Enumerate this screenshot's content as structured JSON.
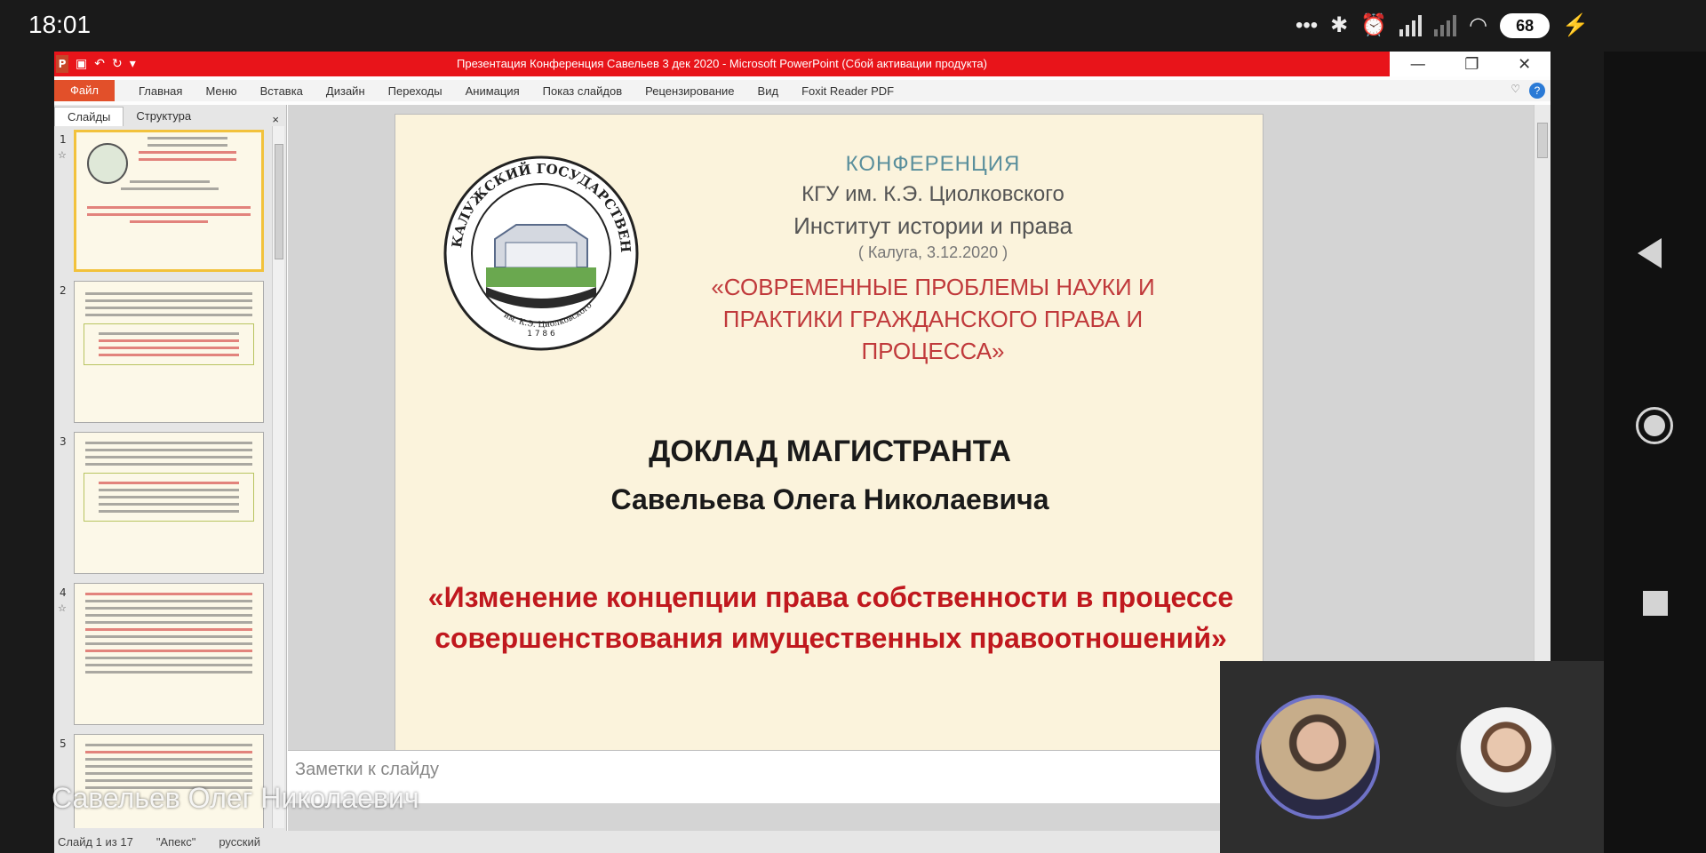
{
  "statusbar": {
    "time": "18:01",
    "battery": "68"
  },
  "window": {
    "title": "Презентация Конференция Савельев 3 дек 2020 - Microsoft PowerPoint (Сбой активации продукта)",
    "menu": [
      "Главная",
      "Меню",
      "Вставка",
      "Дизайн",
      "Переходы",
      "Анимация",
      "Показ слайдов",
      "Рецензирование",
      "Вид",
      "Foxit Reader PDF"
    ],
    "file_label": "Файл",
    "help": "?"
  },
  "left_pane": {
    "tabs": [
      "Слайды",
      "Структура"
    ],
    "close": "×",
    "slide_numbers": [
      "1",
      "2",
      "3",
      "4",
      "5"
    ]
  },
  "slide": {
    "conference": "КОНФЕРЕНЦИЯ",
    "university": "КГУ им. К.Э. Циолковского",
    "institute": "Институт истории и права",
    "place_date": "( Калуга, 3.12.2020 )",
    "theme": "«СОВРЕМЕННЫЕ ПРОБЛЕМЫ НАУКИ И ПРАКТИКИ ГРАЖДАНСКОГО ПРАВА И ПРОЦЕССА»",
    "report_title": "ДОКЛАД МАГИСТРАНТА",
    "author": "Савельева Олега Николаевича",
    "topic": "«Изменение концепции права собственности в процессе совершенствования имущественных правоотношений»",
    "logo_text_top": "КАЛУЖСКИЙ ГОСУДАРСТВЕННЫЙ УНИВЕРСИТЕТ",
    "logo_text_bottom": "им. К.Э. Циолковского",
    "logo_year": "1 7 8 6"
  },
  "notes_placeholder": "Заметки к слайду",
  "status": {
    "slide_info": "Слайд 1 из 17",
    "theme": "\"Апекс\"",
    "language": "русский"
  },
  "call": {
    "speaker_name": "Савельев Олег Николаевич"
  },
  "colors": {
    "title_red": "#e8141a",
    "accent_red": "#c0181e",
    "teal": "#5a8f9c"
  }
}
